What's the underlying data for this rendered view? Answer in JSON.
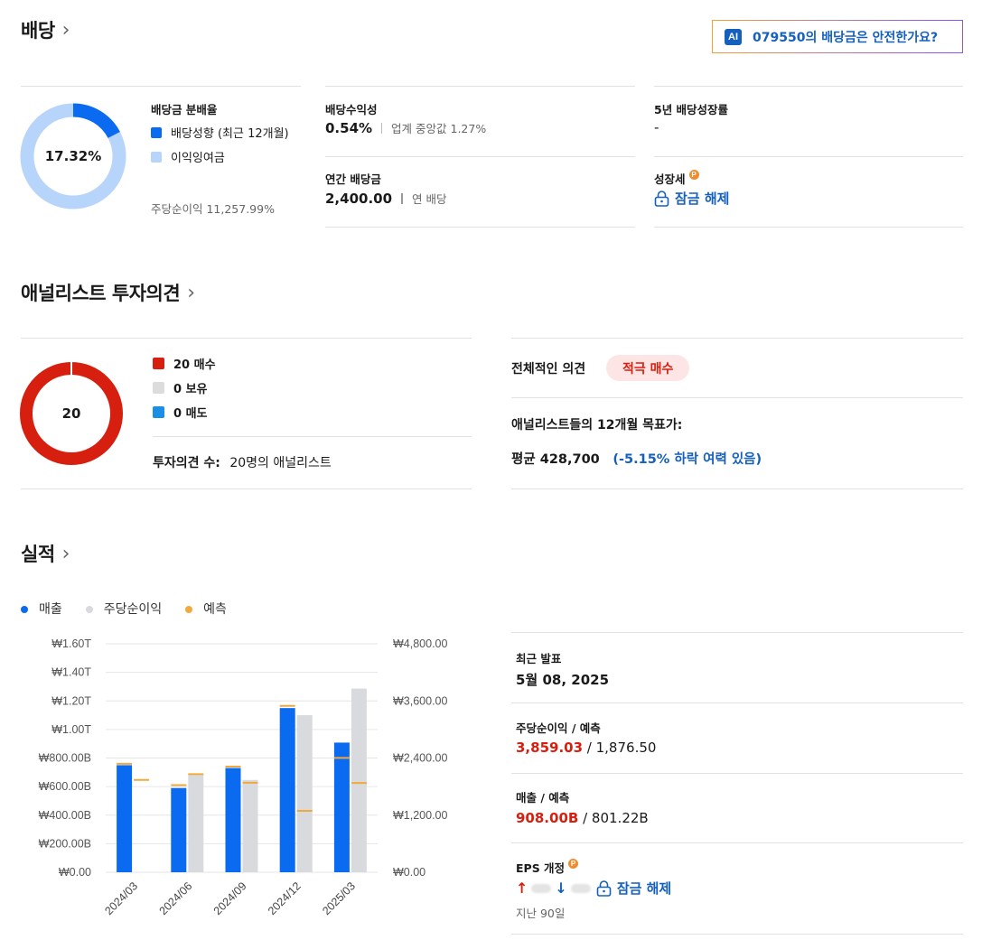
{
  "dividend": {
    "title": "배당",
    "ai_button": {
      "badge": "AI",
      "label": "079550의 배당금은 안전한가요?"
    },
    "payout": {
      "label": "배당금 분배율",
      "center_value": "17.32%",
      "fraction": 0.1732,
      "legend": [
        {
          "label": "배당성향 (최근 12개월)",
          "color": "#0a6af0"
        },
        {
          "label": "이익잉여금",
          "color": "#b7d4fa"
        }
      ],
      "eps_note": "주당순이익 11,257.99%"
    },
    "yield": {
      "label": "배당수익성",
      "value": "0.54%",
      "industry": "업계 중앙값 1.27%"
    },
    "annual": {
      "label": "연간 배당금",
      "value": "2,400.00",
      "note": "연 배당"
    },
    "growth5y": {
      "label": "5년 배당성장률",
      "value": "-"
    },
    "growth": {
      "label": "성장세",
      "p_badge": "P",
      "unlock": "잠금 해제"
    }
  },
  "analyst": {
    "title": "애널리스트 투자의견",
    "total": "20",
    "legend": [
      {
        "label": "20 매수",
        "color": "#d61f0f"
      },
      {
        "label": "0 보유",
        "color": "#dcdcdc"
      },
      {
        "label": "0 매도",
        "color": "#1a8fe3"
      }
    ],
    "count_label": "투자의견 수:",
    "count_value": "20명의 애널리스트",
    "overall_label": "전체적인 의견",
    "overall_value": "적극 매수",
    "target_label": "애널리스트들의 12개월 목표가:",
    "target_avg": "평균 428,700",
    "target_diff": "(-5.15% 하락 여력 있음)"
  },
  "earnings": {
    "title": "실적",
    "legend": [
      {
        "label": "매출",
        "color": "#0a6af0"
      },
      {
        "label": "주당순이익",
        "color": "#d8dadd"
      },
      {
        "label": "예측",
        "color": "#f2a93b"
      }
    ],
    "recent": {
      "label": "최근 발표",
      "value": "5월 08, 2025"
    },
    "eps": {
      "label": "주당순이익 / 예측",
      "actual": "3,859.03",
      "forecast": " / 1,876.50"
    },
    "revenue": {
      "label": "매출 / 예측",
      "actual": "908.00B",
      "forecast": " / 801.22B"
    },
    "revision": {
      "label": "EPS 개정",
      "p_badge": "P",
      "unlock": "잠금 해제",
      "period": "지난 90일"
    }
  },
  "chart_data": {
    "type": "bar",
    "categories": [
      "2024/03",
      "2024/06",
      "2024/09",
      "2024/12",
      "2025/03"
    ],
    "left_ticks": [
      "₩0.00",
      "₩200.00B",
      "₩400.00B",
      "₩600.00B",
      "₩800.00B",
      "₩1.00T",
      "₩1.20T",
      "₩1.40T",
      "₩1.60T"
    ],
    "right_ticks": [
      "₩0.00",
      "₩1,200.00",
      "₩2,400.00",
      "₩3,600.00",
      "₩4,800.00"
    ],
    "ylim_left": [
      0,
      1600
    ],
    "ylim_right": [
      0,
      4800
    ],
    "series": [
      {
        "name": "매출",
        "axis": "left",
        "unit": "B",
        "values": [
          750,
          590,
          730,
          1150,
          908
        ],
        "forecast": [
          760,
          610,
          740,
          1165,
          801
        ]
      },
      {
        "name": "주당순이익",
        "axis": "right",
        "values": [
          null,
          2040,
          1940,
          3300,
          3859
        ],
        "forecast": [
          1940,
          2060,
          1880,
          1290,
          1877
        ]
      }
    ]
  }
}
